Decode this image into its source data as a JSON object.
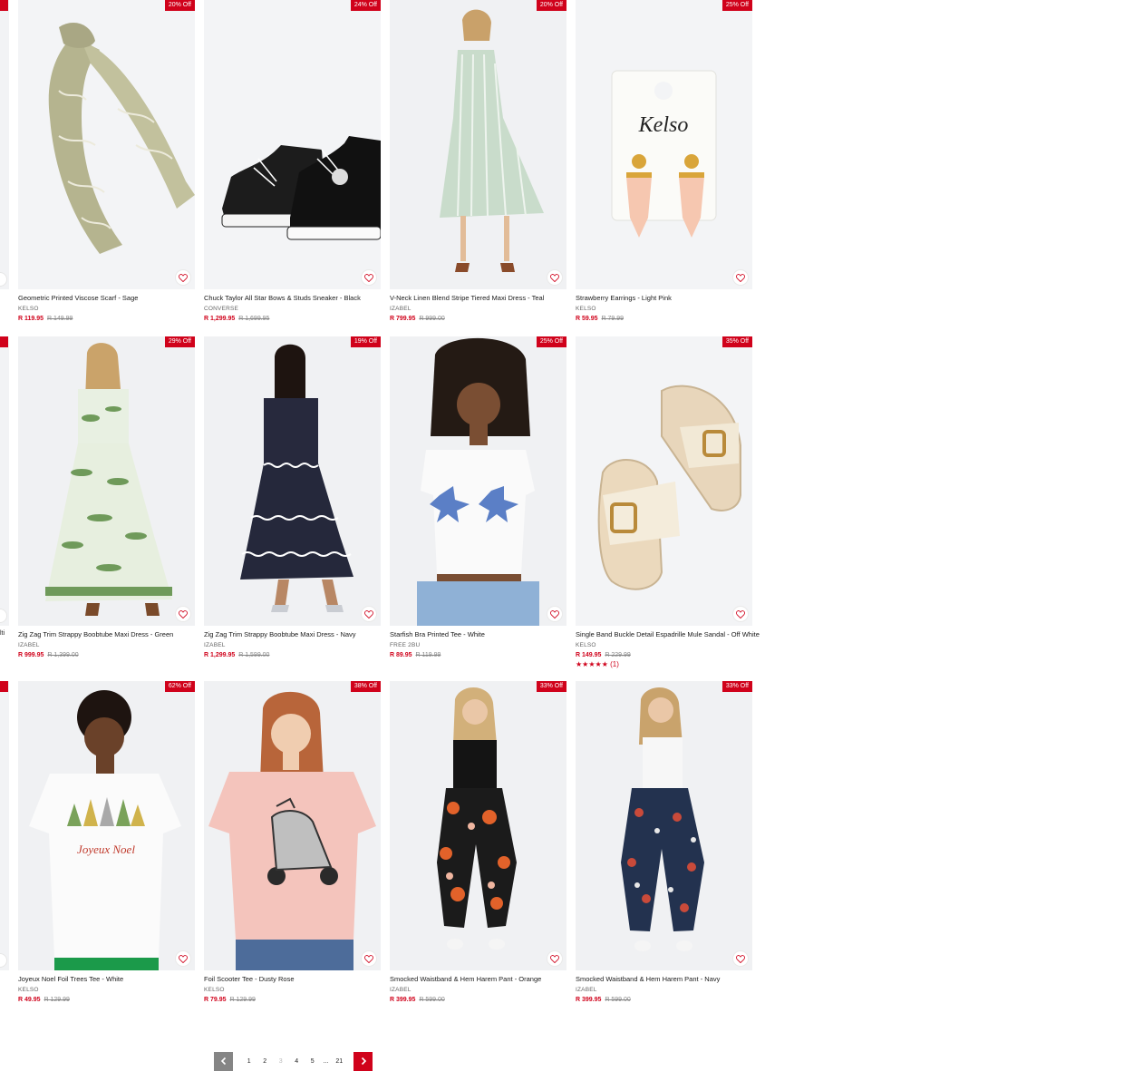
{
  "rows": [
    {
      "edge": {
        "badge": "Off",
        "text": ""
      },
      "products": [
        {
          "title": "Geometric Printed Viscose Scarf - Sage",
          "brand": "KELSO",
          "price": "R 119.95",
          "was": "R 149.99",
          "discount": "20% Off",
          "art": "scarf"
        },
        {
          "title": "Chuck Taylor All Star Bows & Studs Sneaker - Black",
          "brand": "CONVERSE",
          "price": "R 1,299.95",
          "was": "R 1,699.95",
          "discount": "24% Off",
          "art": "sneaker"
        },
        {
          "title": "V-Neck Linen Blend Stripe Tiered Maxi Dress - Teal",
          "brand": "IZABEL",
          "price": "R 799.95",
          "was": "R 999.00",
          "discount": "20% Off",
          "art": "stripe-dress"
        },
        {
          "title": "Strawberry Earrings - Light Pink",
          "brand": "KELSO",
          "price": "R 59.95",
          "was": "R 79.99",
          "discount": "25% Off",
          "art": "earrings",
          "card_text": "Kelso"
        }
      ]
    },
    {
      "edge": {
        "badge": "Off",
        "text": "lti"
      },
      "products": [
        {
          "title": "Zig Zag Trim Strappy Boobtube Maxi Dress - Green",
          "brand": "IZABEL",
          "price": "R 999.95",
          "was": "R 1,399.00",
          "discount": "29% Off",
          "art": "green-dress"
        },
        {
          "title": "Zig Zag Trim Strappy Boobtube Maxi Dress - Navy",
          "brand": "IZABEL",
          "price": "R 1,299.95",
          "was": "R 1,599.00",
          "discount": "19% Off",
          "art": "navy-dress"
        },
        {
          "title": "Starfish Bra Printed Tee - White",
          "brand": "FREE 2BU",
          "price": "R 89.95",
          "was": "R 119.99",
          "discount": "25% Off",
          "art": "starfish-tee"
        },
        {
          "title": "Single Band Buckle Detail Espadrille Mule Sandal - Off White",
          "brand": "KELSO",
          "price": "R 149.95",
          "was": "R 229.99",
          "discount": "35% Off",
          "art": "sandal",
          "rating": "★★★★★",
          "rating_count": "(1)"
        }
      ]
    },
    {
      "edge": {
        "badge": "Off",
        "text": ""
      },
      "products": [
        {
          "title": "Joyeux Noel Foil Trees Tee - White",
          "brand": "KELSO",
          "price": "R 49.95",
          "was": "R 129.99",
          "discount": "62% Off",
          "art": "noel-tee",
          "print_text": "Joyeux Noel"
        },
        {
          "title": "Foil Scooter Tee - Dusty Rose",
          "brand": "KELSO",
          "price": "R 79.95",
          "was": "R 129.99",
          "discount": "38% Off",
          "art": "scooter-tee"
        },
        {
          "title": "Smocked Waistband & Hem Harem Pant - Orange",
          "brand": "IZABEL",
          "price": "R 399.95",
          "was": "R 599.00",
          "discount": "33% Off",
          "art": "harem-orange"
        },
        {
          "title": "Smocked Waistband & Hem Harem Pant - Navy",
          "brand": "IZABEL",
          "price": "R 399.95",
          "was": "R 599.00",
          "discount": "33% Off",
          "art": "harem-navy"
        }
      ]
    }
  ],
  "pagination": {
    "pages": [
      "1",
      "2",
      "3",
      "4",
      "5"
    ],
    "current": "3",
    "ellipsis": "...",
    "last": "21",
    "prev_icon": "chevron-left-icon",
    "next_icon": "chevron-right-icon"
  },
  "colors": {
    "accent": "#d0021b",
    "prev_button": "#858585"
  }
}
